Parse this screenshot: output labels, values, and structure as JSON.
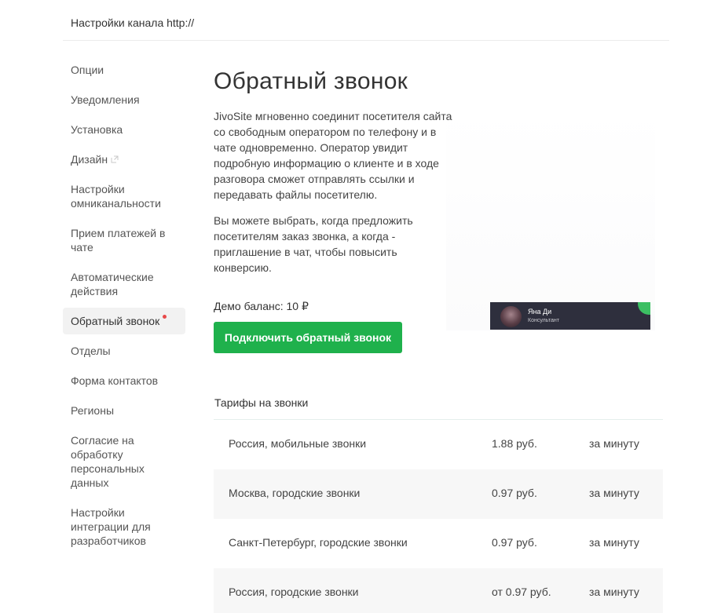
{
  "header": {
    "title": "Настройки канала http://"
  },
  "sidebar": {
    "items": [
      {
        "label": "Опции"
      },
      {
        "label": "Уведомления"
      },
      {
        "label": "Установка"
      },
      {
        "label": "Дизайн",
        "icon": "external-link-icon"
      },
      {
        "label": "Настройки омниканальности"
      },
      {
        "label": "Прием платежей в чате"
      },
      {
        "label": "Автоматические действия"
      },
      {
        "label": "Обратный звонок",
        "active": true,
        "badge": "red-dot"
      },
      {
        "label": "Отделы"
      },
      {
        "label": "Форма контактов"
      },
      {
        "label": "Регионы"
      },
      {
        "label": "Согласие на обработку персональных данных"
      },
      {
        "label": "Настройки интеграции для разработчиков"
      }
    ]
  },
  "main": {
    "title": "Обратный звонок",
    "description_1": "JivoSite мгновенно соединит посетителя сайта со свободным оператором по телефону и в чате одновременно. Оператор увидит подробную информацию о клиенте и в ходе разговора сможет отправлять ссылки и передавать файлы посетителю.",
    "description_2": "Вы можете выбрать, когда предложить посетителям заказ звонка, а когда - приглашение в чат, чтобы повысить конверсию.",
    "balance": "Демо баланс: 10 ₽",
    "connect_button": "Подключить обратный звонок"
  },
  "widget": {
    "agent_name": "Яна Ди",
    "agent_role": "Консультант"
  },
  "tariffs": {
    "title": "Тарифы на звонки",
    "rows": [
      {
        "name": "Россия, мобильные звонки",
        "price": "1.88 руб.",
        "unit": "за минуту"
      },
      {
        "name": "Москва, городские звонки",
        "price": "0.97 руб.",
        "unit": "за минуту"
      },
      {
        "name": "Санкт-Петербург, городские звонки",
        "price": "0.97 руб.",
        "unit": "за минуту"
      },
      {
        "name": "Россия, городские звонки",
        "price": "от 0.97 руб.",
        "unit": "за минуту"
      }
    ]
  },
  "colors": {
    "accent_green": "#1fb14c",
    "badge_red": "#e84a4a",
    "widget_bg": "#2e2f3d"
  }
}
